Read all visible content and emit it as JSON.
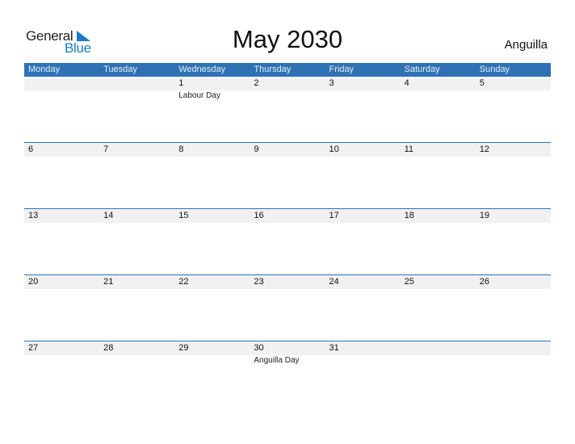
{
  "logo": {
    "word1": "General",
    "word2": "Blue"
  },
  "title": "May 2030",
  "country": "Anguilla",
  "colors": {
    "accent": "#2e72b4",
    "logo_blue": "#1a7bc4",
    "day_bar": "#f1f1f1"
  },
  "weekdays": [
    "Monday",
    "Tuesday",
    "Wednesday",
    "Thursday",
    "Friday",
    "Saturday",
    "Sunday"
  ],
  "weeks": [
    {
      "days": [
        "",
        "",
        "1",
        "2",
        "3",
        "4",
        "5"
      ],
      "events": [
        "",
        "",
        "Labour Day",
        "",
        "",
        "",
        ""
      ]
    },
    {
      "days": [
        "6",
        "7",
        "8",
        "9",
        "10",
        "11",
        "12"
      ],
      "events": [
        "",
        "",
        "",
        "",
        "",
        "",
        ""
      ]
    },
    {
      "days": [
        "13",
        "14",
        "15",
        "16",
        "17",
        "18",
        "19"
      ],
      "events": [
        "",
        "",
        "",
        "",
        "",
        "",
        ""
      ]
    },
    {
      "days": [
        "20",
        "21",
        "22",
        "23",
        "24",
        "25",
        "26"
      ],
      "events": [
        "",
        "",
        "",
        "",
        "",
        "",
        ""
      ]
    },
    {
      "days": [
        "27",
        "28",
        "29",
        "30",
        "31",
        "",
        ""
      ],
      "events": [
        "",
        "",
        "",
        "Anguilla Day",
        "",
        "",
        ""
      ]
    }
  ]
}
